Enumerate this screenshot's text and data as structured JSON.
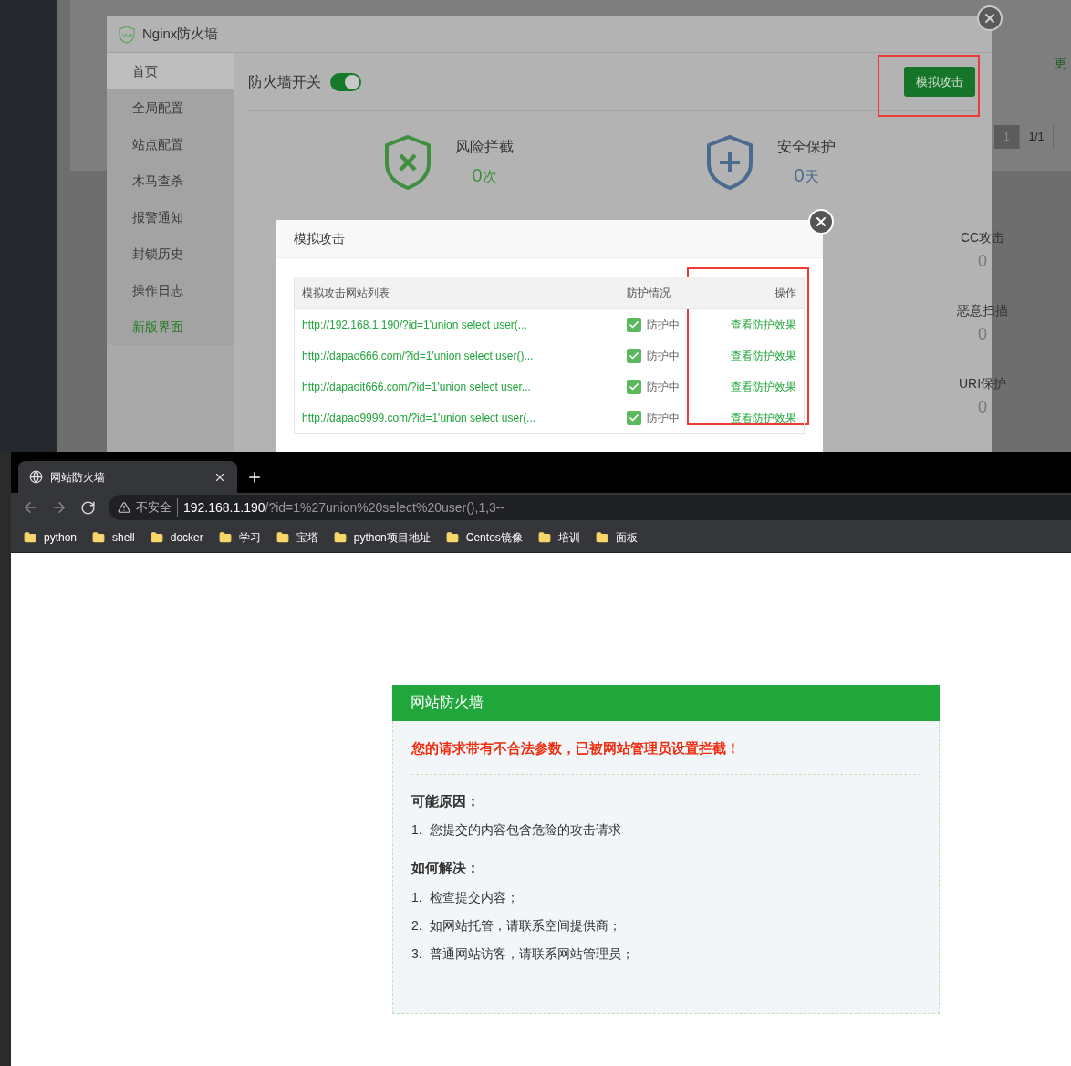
{
  "background_page": {
    "link": "更",
    "pagination": [
      {
        "label": "1",
        "selected": true
      },
      {
        "label": "1/1",
        "selected": false
      }
    ]
  },
  "firewall_window": {
    "title": "Nginx防火墙",
    "sidebar": [
      {
        "label": "首页",
        "selected": true,
        "kind": "normal"
      },
      {
        "label": "全局配置",
        "selected": false,
        "kind": "normal"
      },
      {
        "label": "站点配置",
        "selected": false,
        "kind": "normal"
      },
      {
        "label": "木马查杀",
        "selected": false,
        "kind": "normal"
      },
      {
        "label": "报警通知",
        "selected": false,
        "kind": "normal"
      },
      {
        "label": "封锁历史",
        "selected": false,
        "kind": "normal"
      },
      {
        "label": "操作日志",
        "selected": false,
        "kind": "normal"
      },
      {
        "label": "新版界面",
        "selected": false,
        "kind": "accent"
      }
    ],
    "switch": {
      "label": "防火墙开关",
      "on": true
    },
    "simulate_button": "模拟攻击",
    "stats": [
      {
        "kind": "blocked",
        "label": "风险拦截",
        "value": "0",
        "unit": "次"
      },
      {
        "kind": "protected",
        "label": "安全保护",
        "value": "0",
        "unit": "天"
      }
    ],
    "side_stats": [
      {
        "label": "CC攻击",
        "value": "0"
      },
      {
        "label": "恶意扫描",
        "value": "0"
      },
      {
        "label": "URI保护",
        "value": "0"
      }
    ]
  },
  "attack_dialog": {
    "title": "模拟攻击",
    "columns": [
      "模拟攻击网站列表",
      "防护情况",
      "操作"
    ],
    "rows": [
      {
        "url": "http://192.168.1.190/?id=1'union select user(...",
        "checked": true,
        "status": "防护中",
        "action": "查看防护效果"
      },
      {
        "url": "http://dapao666.com/?id=1'union select user()...",
        "checked": true,
        "status": "防护中",
        "action": "查看防护效果"
      },
      {
        "url": "http://dapaoit666.com/?id=1'union select user...",
        "checked": true,
        "status": "防护中",
        "action": "查看防护效果"
      },
      {
        "url": "http://dapao9999.com/?id=1'union select user(...",
        "checked": true,
        "status": "防护中",
        "action": "查看防护效果"
      }
    ]
  },
  "browser": {
    "tab": {
      "title": "网站防火墙"
    },
    "security": "不安全",
    "url_host": "192.168.1.190",
    "url_path": "/?id=1%27union%20select%20user(),1,3--",
    "bookmarks": [
      "python",
      "shell",
      "docker",
      "学习",
      "宝塔",
      "python项目地址",
      "Centos镜像",
      "培训",
      "面板"
    ]
  },
  "block_page": {
    "title": "网站防火墙",
    "alert": "您的请求带有不合法参数，已被网站管理员设置拦截！",
    "sections": [
      {
        "heading": "可能原因：",
        "items": [
          {
            "number": "1.",
            "text": "您提交的内容包含危险的攻击请求"
          }
        ]
      },
      {
        "heading": "如何解决：",
        "items": [
          {
            "number": "1.",
            "text": "检查提交内容；"
          },
          {
            "number": "2.",
            "text": "如网站托管，请联系空间提供商；"
          },
          {
            "number": "3.",
            "text": "普通网站访客，请联系网站管理员；"
          }
        ]
      }
    ]
  }
}
